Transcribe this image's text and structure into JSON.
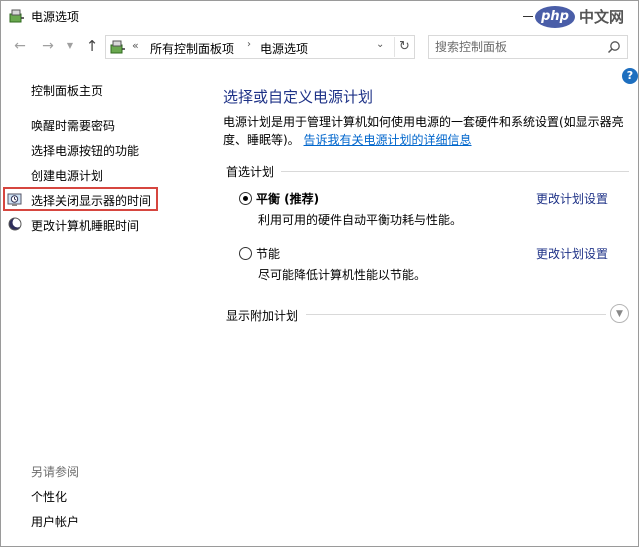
{
  "window": {
    "title": "电源选项"
  },
  "watermark": {
    "logo": "php",
    "text": "中文网"
  },
  "nav": {
    "breadcrumb_overflow": "«",
    "breadcrumbs": [
      "所有控制面板项",
      "电源选项"
    ],
    "search_placeholder": "搜索控制面板"
  },
  "sidebar": {
    "home": "控制面板主页",
    "links": [
      "唤醒时需要密码",
      "选择电源按钮的功能",
      "创建电源计划",
      "选择关闭显示器的时间",
      "更改计算机睡眠时间"
    ],
    "see_also": "另请参阅",
    "see_also_links": [
      "个性化",
      "用户帐户"
    ]
  },
  "main": {
    "title": "选择或自定义电源计划",
    "description": "电源计划是用于管理计算机如何使用电源的一套硬件和系统设置(如显示器亮度、睡眠等)。",
    "description_link": "告诉我有关电源计划的详细信息",
    "preferred_label": "首选计划",
    "plans": [
      {
        "name": "平衡 (推荐)",
        "description": "利用可用的硬件自动平衡功耗与性能。",
        "link": "更改计划设置",
        "selected": true
      },
      {
        "name": "节能",
        "description": "尽可能降低计算机性能以节能。",
        "link": "更改计划设置",
        "selected": false
      }
    ],
    "extra_label": "显示附加计划"
  },
  "colors": {
    "title_blue": "#1e3287",
    "link_blue": "#0066cc",
    "highlight_red": "#d6463f"
  }
}
